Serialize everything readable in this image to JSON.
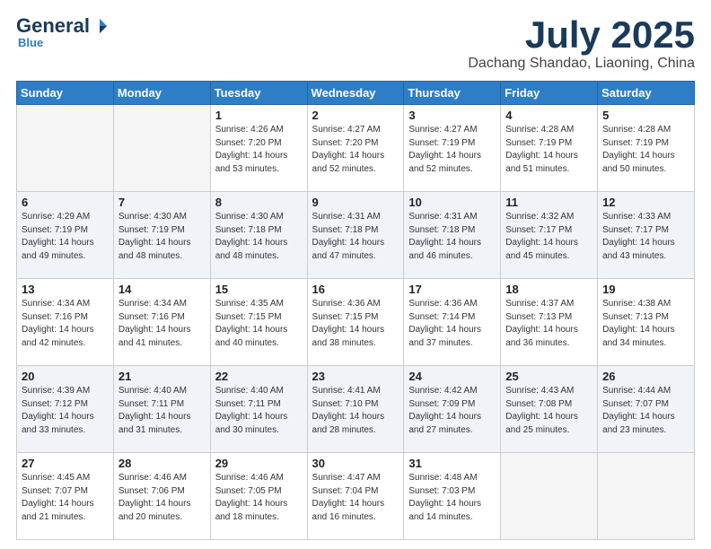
{
  "header": {
    "logo_general": "General",
    "logo_blue": "Blue",
    "month": "July 2025",
    "location": "Dachang Shandao, Liaoning, China"
  },
  "days_of_week": [
    "Sunday",
    "Monday",
    "Tuesday",
    "Wednesday",
    "Thursday",
    "Friday",
    "Saturday"
  ],
  "weeks": [
    [
      {
        "day": "",
        "info": ""
      },
      {
        "day": "",
        "info": ""
      },
      {
        "day": "1",
        "info": "Sunrise: 4:26 AM\nSunset: 7:20 PM\nDaylight: 14 hours\nand 53 minutes."
      },
      {
        "day": "2",
        "info": "Sunrise: 4:27 AM\nSunset: 7:20 PM\nDaylight: 14 hours\nand 52 minutes."
      },
      {
        "day": "3",
        "info": "Sunrise: 4:27 AM\nSunset: 7:19 PM\nDaylight: 14 hours\nand 52 minutes."
      },
      {
        "day": "4",
        "info": "Sunrise: 4:28 AM\nSunset: 7:19 PM\nDaylight: 14 hours\nand 51 minutes."
      },
      {
        "day": "5",
        "info": "Sunrise: 4:28 AM\nSunset: 7:19 PM\nDaylight: 14 hours\nand 50 minutes."
      }
    ],
    [
      {
        "day": "6",
        "info": "Sunrise: 4:29 AM\nSunset: 7:19 PM\nDaylight: 14 hours\nand 49 minutes."
      },
      {
        "day": "7",
        "info": "Sunrise: 4:30 AM\nSunset: 7:19 PM\nDaylight: 14 hours\nand 48 minutes."
      },
      {
        "day": "8",
        "info": "Sunrise: 4:30 AM\nSunset: 7:18 PM\nDaylight: 14 hours\nand 48 minutes."
      },
      {
        "day": "9",
        "info": "Sunrise: 4:31 AM\nSunset: 7:18 PM\nDaylight: 14 hours\nand 47 minutes."
      },
      {
        "day": "10",
        "info": "Sunrise: 4:31 AM\nSunset: 7:18 PM\nDaylight: 14 hours\nand 46 minutes."
      },
      {
        "day": "11",
        "info": "Sunrise: 4:32 AM\nSunset: 7:17 PM\nDaylight: 14 hours\nand 45 minutes."
      },
      {
        "day": "12",
        "info": "Sunrise: 4:33 AM\nSunset: 7:17 PM\nDaylight: 14 hours\nand 43 minutes."
      }
    ],
    [
      {
        "day": "13",
        "info": "Sunrise: 4:34 AM\nSunset: 7:16 PM\nDaylight: 14 hours\nand 42 minutes."
      },
      {
        "day": "14",
        "info": "Sunrise: 4:34 AM\nSunset: 7:16 PM\nDaylight: 14 hours\nand 41 minutes."
      },
      {
        "day": "15",
        "info": "Sunrise: 4:35 AM\nSunset: 7:15 PM\nDaylight: 14 hours\nand 40 minutes."
      },
      {
        "day": "16",
        "info": "Sunrise: 4:36 AM\nSunset: 7:15 PM\nDaylight: 14 hours\nand 38 minutes."
      },
      {
        "day": "17",
        "info": "Sunrise: 4:36 AM\nSunset: 7:14 PM\nDaylight: 14 hours\nand 37 minutes."
      },
      {
        "day": "18",
        "info": "Sunrise: 4:37 AM\nSunset: 7:13 PM\nDaylight: 14 hours\nand 36 minutes."
      },
      {
        "day": "19",
        "info": "Sunrise: 4:38 AM\nSunset: 7:13 PM\nDaylight: 14 hours\nand 34 minutes."
      }
    ],
    [
      {
        "day": "20",
        "info": "Sunrise: 4:39 AM\nSunset: 7:12 PM\nDaylight: 14 hours\nand 33 minutes."
      },
      {
        "day": "21",
        "info": "Sunrise: 4:40 AM\nSunset: 7:11 PM\nDaylight: 14 hours\nand 31 minutes."
      },
      {
        "day": "22",
        "info": "Sunrise: 4:40 AM\nSunset: 7:11 PM\nDaylight: 14 hours\nand 30 minutes."
      },
      {
        "day": "23",
        "info": "Sunrise: 4:41 AM\nSunset: 7:10 PM\nDaylight: 14 hours\nand 28 minutes."
      },
      {
        "day": "24",
        "info": "Sunrise: 4:42 AM\nSunset: 7:09 PM\nDaylight: 14 hours\nand 27 minutes."
      },
      {
        "day": "25",
        "info": "Sunrise: 4:43 AM\nSunset: 7:08 PM\nDaylight: 14 hours\nand 25 minutes."
      },
      {
        "day": "26",
        "info": "Sunrise: 4:44 AM\nSunset: 7:07 PM\nDaylight: 14 hours\nand 23 minutes."
      }
    ],
    [
      {
        "day": "27",
        "info": "Sunrise: 4:45 AM\nSunset: 7:07 PM\nDaylight: 14 hours\nand 21 minutes."
      },
      {
        "day": "28",
        "info": "Sunrise: 4:46 AM\nSunset: 7:06 PM\nDaylight: 14 hours\nand 20 minutes."
      },
      {
        "day": "29",
        "info": "Sunrise: 4:46 AM\nSunset: 7:05 PM\nDaylight: 14 hours\nand 18 minutes."
      },
      {
        "day": "30",
        "info": "Sunrise: 4:47 AM\nSunset: 7:04 PM\nDaylight: 14 hours\nand 16 minutes."
      },
      {
        "day": "31",
        "info": "Sunrise: 4:48 AM\nSunset: 7:03 PM\nDaylight: 14 hours\nand 14 minutes."
      },
      {
        "day": "",
        "info": ""
      },
      {
        "day": "",
        "info": ""
      }
    ]
  ]
}
